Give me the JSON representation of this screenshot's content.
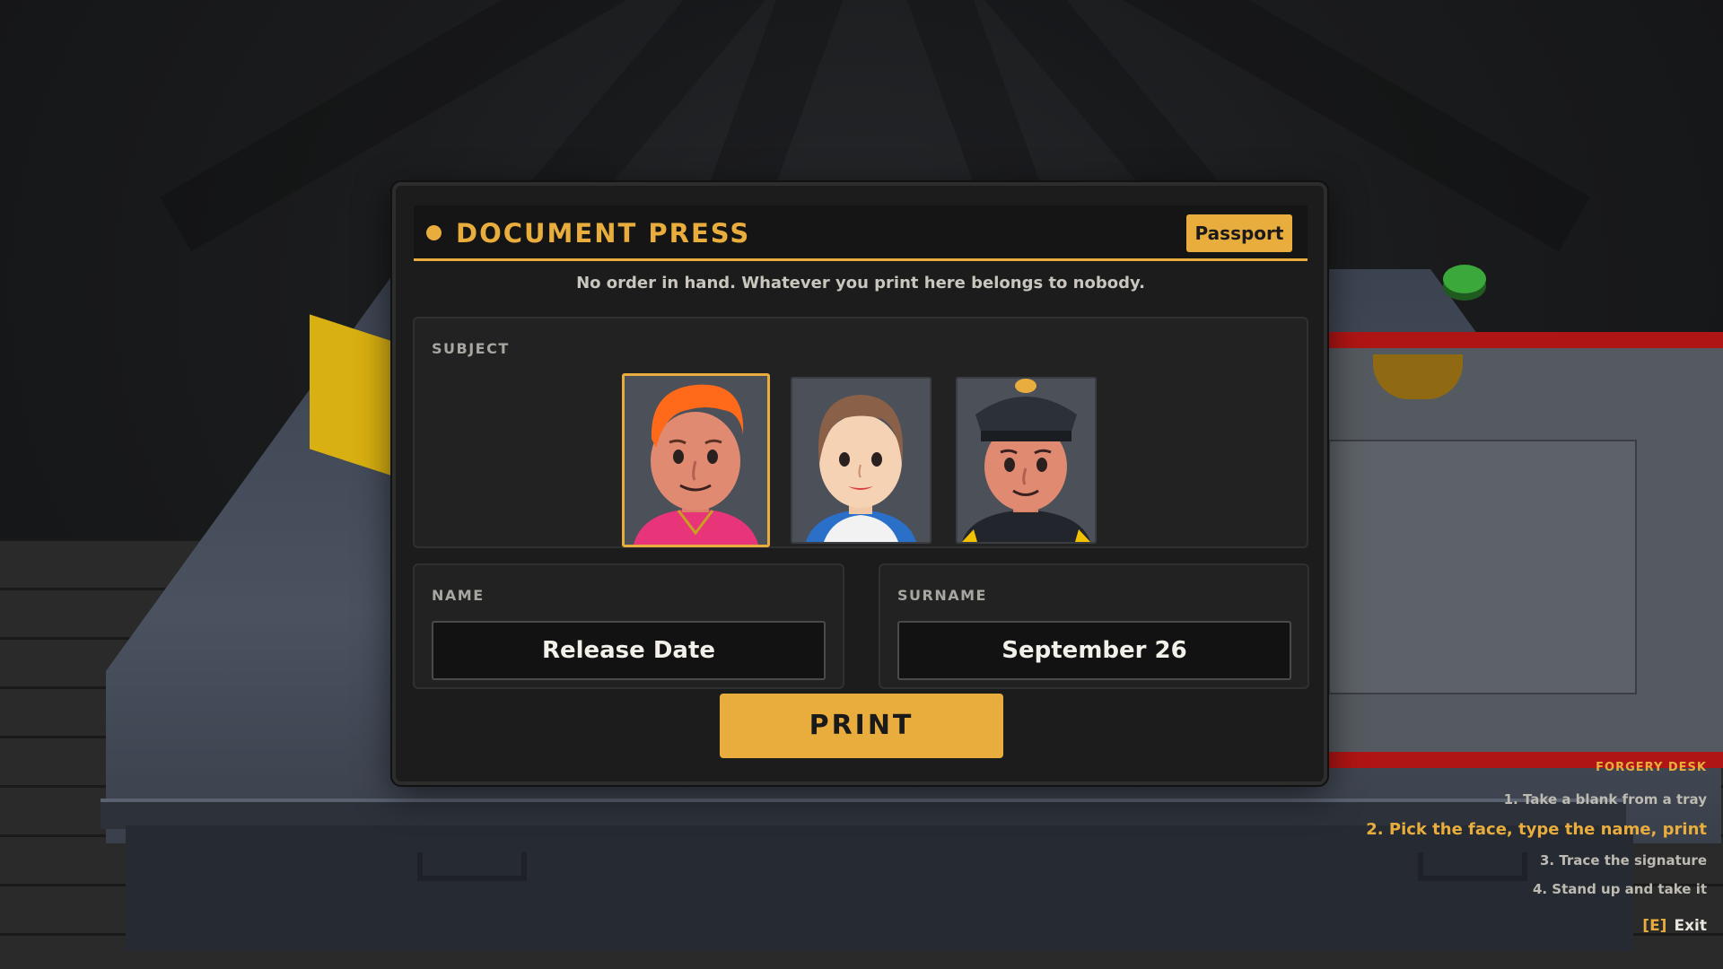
{
  "panel": {
    "title": "DOCUMENT PRESS",
    "document_type": "Passport",
    "subtitle": "No order in hand. Whatever you print here belongs to nobody."
  },
  "subject": {
    "label": "SUBJECT",
    "portraits": [
      {
        "id": "orange-hair-man",
        "selected": true
      },
      {
        "id": "brown-hair-woman",
        "selected": false
      },
      {
        "id": "police-officer",
        "selected": false
      }
    ]
  },
  "name": {
    "label": "NAME",
    "value": "Release Date"
  },
  "surname": {
    "label": "SURNAME",
    "value": "September 26"
  },
  "print_label": "PRINT",
  "objectives": {
    "title": "FORGERY DESK",
    "steps": [
      "1. Take a blank from a tray",
      "2. Pick the face, type the name, print",
      "3. Trace the signature",
      "4. Stand up and take it"
    ],
    "active_step": 1
  },
  "exit": {
    "key": "[E]",
    "label": "Exit"
  },
  "colors": {
    "accent": "#e8ad3c",
    "panel_bg": "#1c1c1c"
  }
}
